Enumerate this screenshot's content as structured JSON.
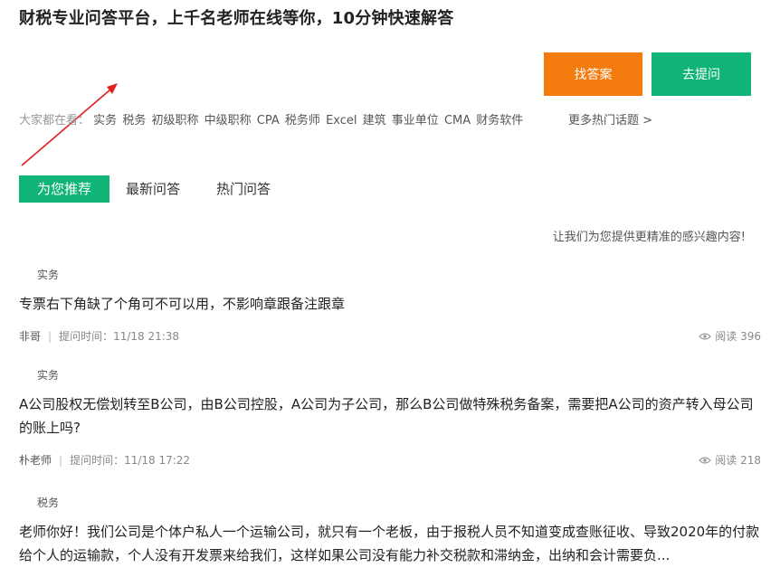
{
  "header": {
    "title": "财税专业问答平台，上千名老师在线等你，10分钟快速解答",
    "find_answer_label": "找答案",
    "ask_label": "去提问"
  },
  "hot_topics": {
    "prefix": "大家都在看：",
    "tags": [
      "实务",
      "税务",
      "初级职称",
      "中级职称",
      "CPA",
      "税务师",
      "Excel",
      "建筑",
      "事业单位",
      "CMA",
      "财务软件"
    ],
    "more_label": "更多热门话题 >"
  },
  "tabs": [
    {
      "label": "为您推荐",
      "active": true
    },
    {
      "label": "最新问答",
      "active": false
    },
    {
      "label": "热门问答",
      "active": false
    }
  ],
  "hint": "让我们为您提供更精准的感兴趣内容!",
  "questions": [
    {
      "category": "实务",
      "title": "专票右下角缺了个角可不可以用，不影响章跟备注跟章",
      "author": "非哥",
      "time": "提问时间：11/18 21:38",
      "reads": "阅读 396"
    },
    {
      "category": "实务",
      "title": "A公司股权无偿划转至B公司，由B公司控股，A公司为子公司，那么B公司做特殊税务备案，需要把A公司的资产转入母公司的账上吗?",
      "author": "朴老师",
      "time": "提问时间：11/18 17:22",
      "reads": "阅读 218"
    },
    {
      "category": "税务",
      "title": "老师你好！我们公司是个体户私人一个运输公司，就只有一个老板，由于报税人员不知道变成查账征收、导致2020年的付款给个人的运输款，个人没有开发票来给我们，这样如果公司没有能力补交税款和滞纳金，出纳和会计需要负...",
      "author": "",
      "time": "",
      "reads": ""
    }
  ],
  "colors": {
    "find_answer": "#f47c0f",
    "ask": "#10b476",
    "active_tab": "#10b476",
    "arrow": "#e02020"
  }
}
